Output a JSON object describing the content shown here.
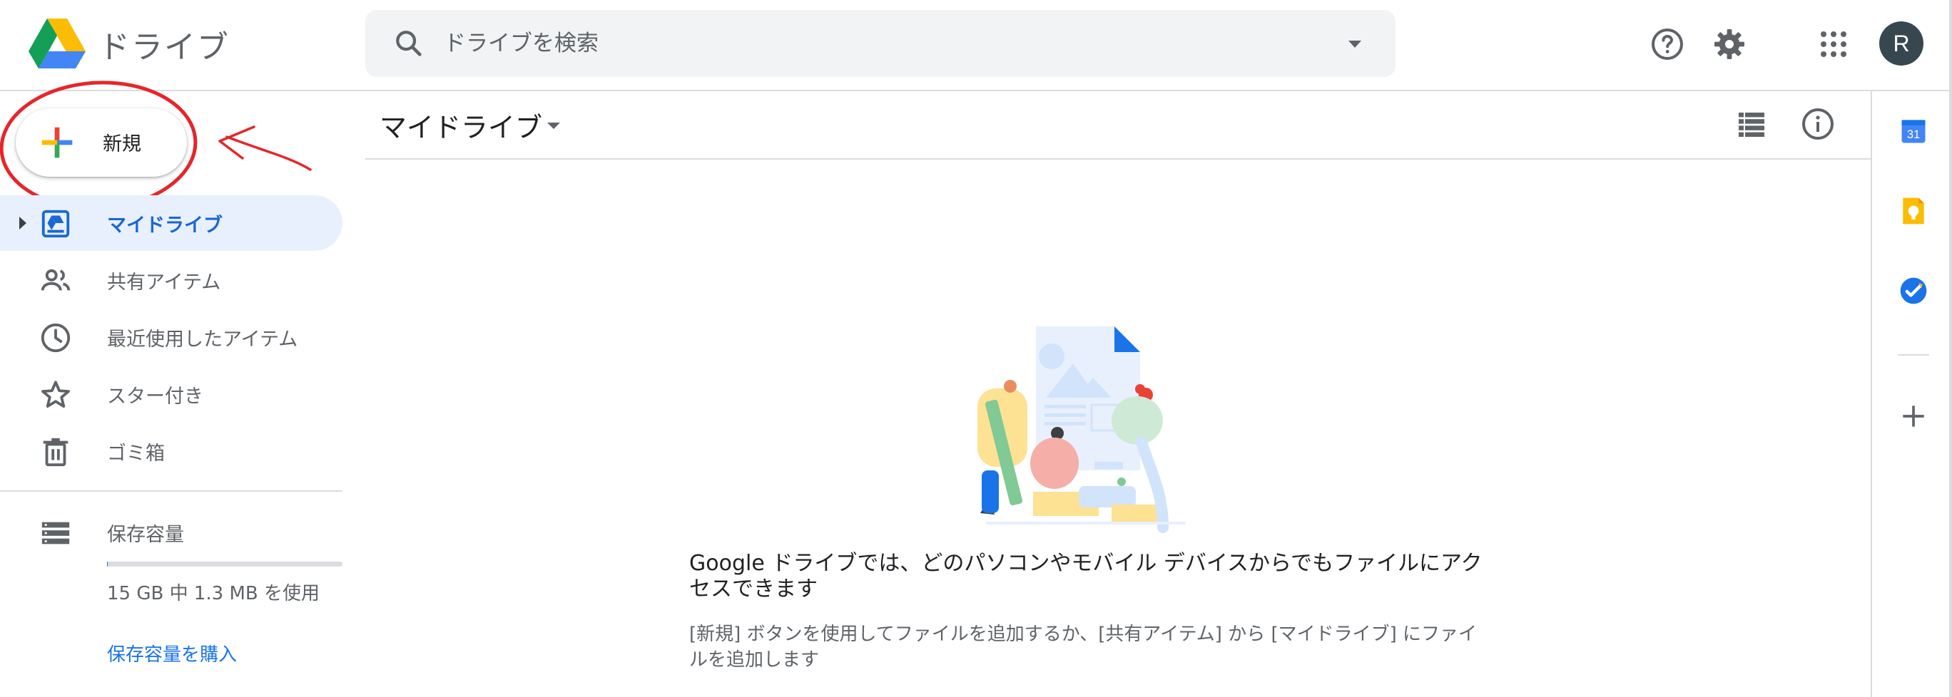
{
  "app": {
    "title": "ドライブ"
  },
  "search": {
    "placeholder": "ドライブを検索"
  },
  "header": {
    "avatar_letter": "R"
  },
  "new_button": {
    "label": "新規"
  },
  "sidebar": {
    "items": [
      {
        "label": "マイドライブ",
        "active": true
      },
      {
        "label": "共有アイテム"
      },
      {
        "label": "最近使用したアイテム"
      },
      {
        "label": "スター付き"
      },
      {
        "label": "ゴミ箱"
      }
    ],
    "storage": {
      "label": "保存容量",
      "usage": "15 GB 中 1.3 MB を使用",
      "used_fraction": 0.0001,
      "buy_label": "保存容量を購入"
    }
  },
  "main": {
    "title": "マイドライブ",
    "empty_heading": "Google ドライブでは、どのパソコンやモバイル デバイスからでもファイルにアクセスできます",
    "empty_body": "[新規] ボタンを使用してファイルを追加するか、[共有アイテム] から [マイドライブ] にファイルを追加します"
  },
  "rail": {
    "calendar_day": "31"
  },
  "colors": {
    "active_bg": "#e8f0fe",
    "active_text": "#1967d2",
    "link": "#1a73e8",
    "annotation": "#e5262a"
  }
}
